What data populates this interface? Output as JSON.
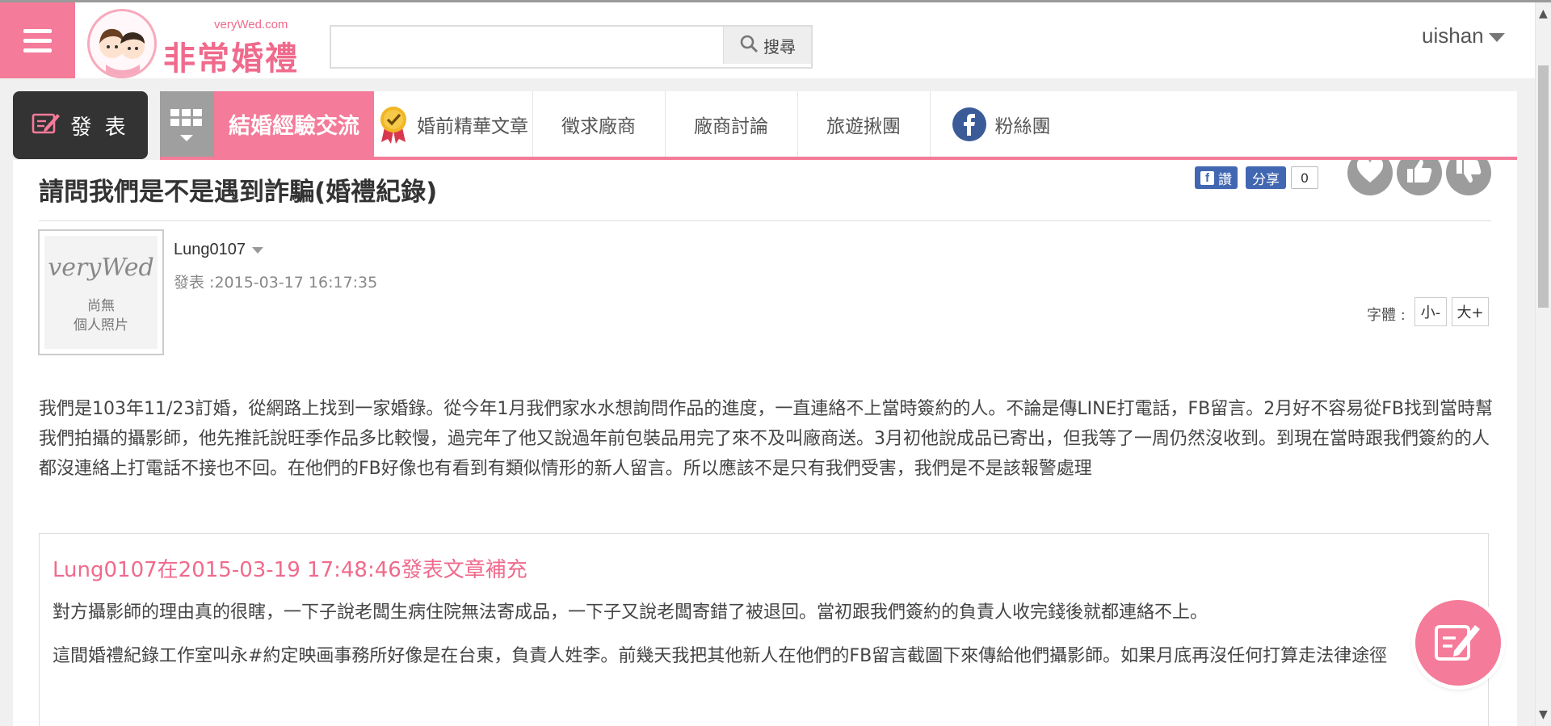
{
  "header": {
    "logo_domain": "veryWed.com",
    "logo_title": "非常婚禮",
    "search_placeholder": "",
    "search_button": "搜尋",
    "username": "uishan"
  },
  "nav": {
    "post_button": "發 表",
    "tabs": [
      {
        "label": "結婚經驗交流",
        "active": true
      },
      {
        "label": "婚前精華文章",
        "icon": "medal-icon"
      },
      {
        "label": "徵求廠商"
      },
      {
        "label": "廠商討論"
      },
      {
        "label": "旅遊揪團"
      },
      {
        "label": "粉絲團",
        "icon": "facebook-icon"
      }
    ]
  },
  "post": {
    "title": "請問我們是不是遇到詐騙(婚禮紀錄)",
    "fb_like": "讚",
    "fb_share": "分享",
    "fb_count": "0",
    "avatar_script": "veryWed",
    "avatar_line1": "尚無",
    "avatar_line2": "個人照片",
    "author": "Lung0107",
    "posted": "發表 :2015-03-17 16:17:35",
    "font_label": "字體 :",
    "font_small": "小-",
    "font_large": "大+",
    "body": "我們是103年11/23訂婚，從網路上找到一家婚錄。從今年1月我們家水水想詢問作品的進度，一直連絡不上當時簽約的人。不論是傳LINE打電話，FB留言。2月好不容易從FB找到當時幫我們拍攝的攝影師，他先推託說旺季作品多比較慢，過完年了他又說過年前包裝品用完了來不及叫廠商送。3月初他說成品已寄出，但我等了一周仍然沒收到。到現在當時跟我們簽約的人都沒連絡上打電話不接也不回。在他們的FB好像也有看到有類似情形的新人留言。所以應該不是只有我們受害，我們是不是該報警處理"
  },
  "supplement": {
    "heading": "Lung0107在2015-03-19 17:48:46發表文章補充",
    "p1": "對方攝影師的理由真的很瞎，一下子說老闆生病住院無法寄成品，一下子又說老闆寄錯了被退回。當初跟我們簽約的負責人收完錢後就都連絡不上。",
    "p2": "這間婚禮紀錄工作室叫永#約定映画事務所好像是在台東，負責人姓李。前幾天我把其他新人在他們的FB留言截圖下來傳給他們攝影師。如果月底再沒任何打算走法律途徑"
  },
  "colors": {
    "brand_pink": "#f47b99",
    "dark": "#333333",
    "facebook_blue": "#4267b2"
  }
}
